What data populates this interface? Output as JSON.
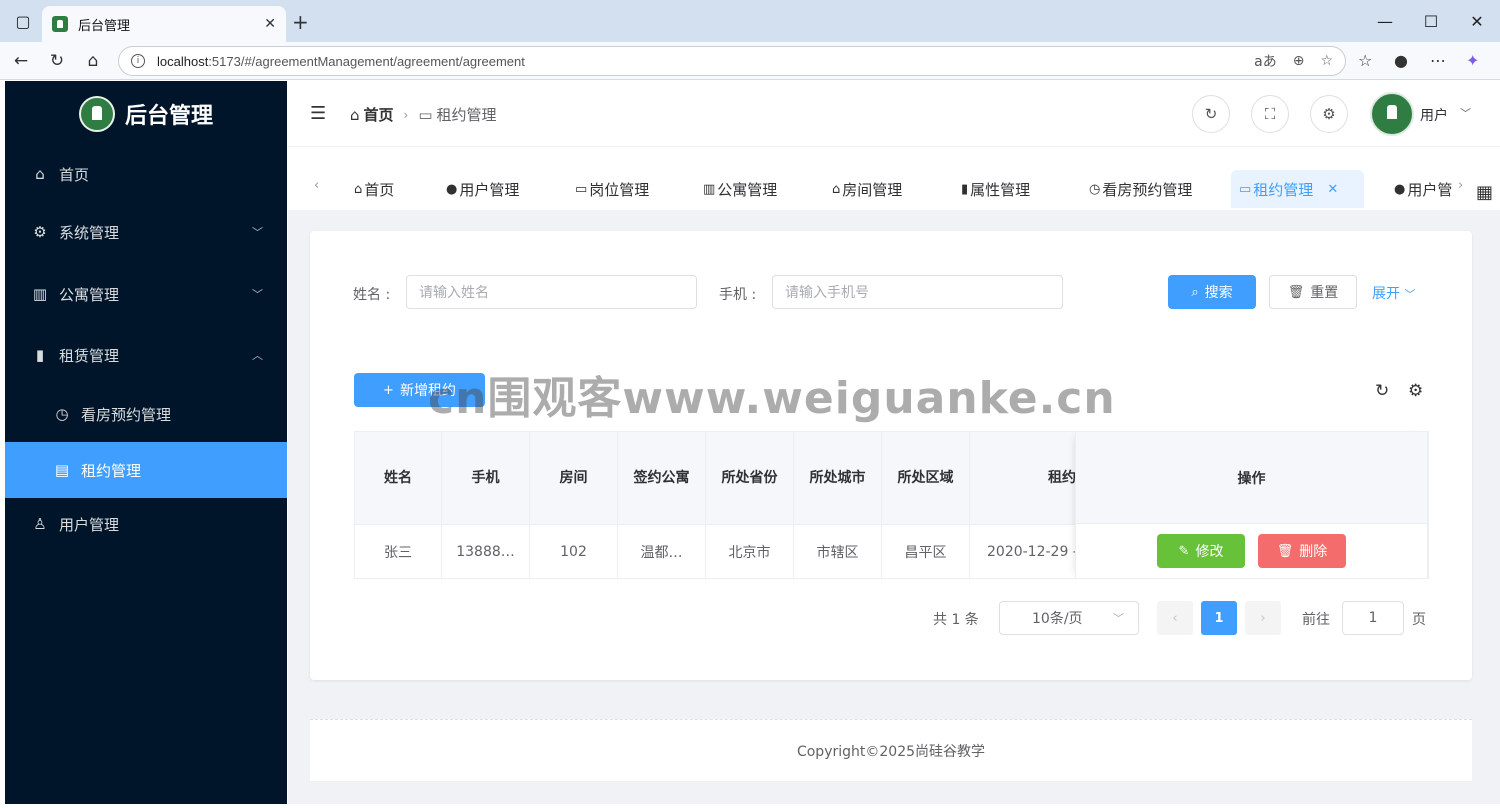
{
  "browser": {
    "tab_title": "后台管理",
    "url_host": "localhost",
    "url_rest": ":5173/#/agreementManagement/agreement/agreement"
  },
  "sidebar": {
    "logo_text": "后台管理",
    "items": [
      {
        "label": "首页",
        "icon": "home-icon"
      },
      {
        "label": "系统管理",
        "icon": "gear-icon"
      },
      {
        "label": "公寓管理",
        "icon": "building-icon"
      },
      {
        "label": "租赁管理",
        "icon": "books-icon"
      },
      {
        "label": "看房预约管理",
        "icon": "clock-icon"
      },
      {
        "label": "租约管理",
        "icon": "document-icon"
      },
      {
        "label": "用户管理",
        "icon": "user-icon"
      }
    ]
  },
  "header": {
    "breadcrumb_home": "首页",
    "breadcrumb_current": "租约管理",
    "user_name": "用户"
  },
  "tabs": [
    {
      "label": "首页",
      "icon": "home-icon"
    },
    {
      "label": "用户管理",
      "icon": "user-icon"
    },
    {
      "label": "岗位管理",
      "icon": "idcard-icon"
    },
    {
      "label": "公寓管理",
      "icon": "building-icon"
    },
    {
      "label": "房间管理",
      "icon": "house-icon"
    },
    {
      "label": "属性管理",
      "icon": "clipboard-icon"
    },
    {
      "label": "看房预约管理",
      "icon": "clock-icon"
    },
    {
      "label": "租约管理",
      "icon": "card-icon"
    },
    {
      "label": "用户管",
      "icon": "user-icon"
    }
  ],
  "search": {
    "name_label": "姓名 :",
    "name_placeholder": "请输入姓名",
    "phone_label": "手机 :",
    "phone_placeholder": "请输入手机号",
    "search_button": "搜索",
    "reset_button": "重置",
    "expand_link": "展开"
  },
  "toolbar": {
    "add_button": "新增租约"
  },
  "table": {
    "columns": [
      "姓名",
      "手机",
      "房间",
      "签约公寓",
      "所处省份",
      "所处城市",
      "所处区域",
      "租约"
    ],
    "operation_header": "操作",
    "rows": [
      {
        "cells": [
          "张三",
          "13888…",
          "102",
          "温都…",
          "北京市",
          "市辖区",
          "昌平区",
          "2020-12-29 -"
        ]
      }
    ],
    "edit_button": "修改",
    "delete_button": "删除"
  },
  "pagination": {
    "total": "共 1 条",
    "page_size": "10条/页",
    "current_page": "1",
    "goto_label": "前往",
    "goto_value": "1",
    "page_suffix": "页"
  },
  "footer": {
    "copyright": "Copyright©2025尚硅谷教学"
  },
  "watermark": "cn围观客www.weiguanke.cn",
  "colors": {
    "sidebar_bg": "#001529",
    "primary": "#409eff",
    "success": "#67c23a",
    "danger": "#f56c6c"
  }
}
